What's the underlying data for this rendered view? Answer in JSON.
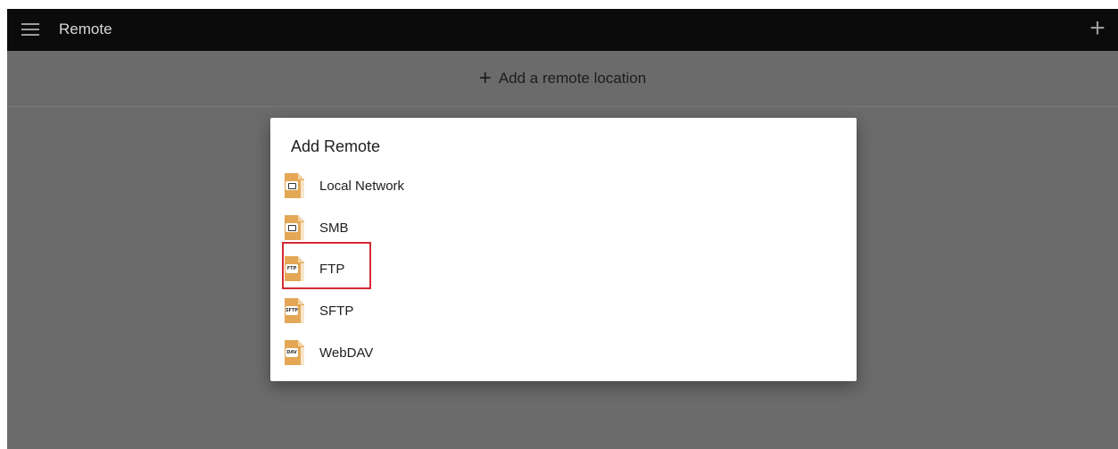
{
  "appbar": {
    "title": "Remote",
    "menu_icon": "hamburger-menu-icon",
    "add_icon": "plus-icon"
  },
  "add_location": {
    "icon": "plus-icon",
    "label": "Add a remote location"
  },
  "dialog": {
    "title": "Add Remote",
    "options": [
      {
        "label": "Local Network",
        "icon": "local-network-icon",
        "badge": ""
      },
      {
        "label": "SMB",
        "icon": "smb-icon",
        "badge": ""
      },
      {
        "label": "FTP",
        "icon": "ftp-icon",
        "badge": "FTP"
      },
      {
        "label": "SFTP",
        "icon": "sftp-icon",
        "badge": "SFTP"
      },
      {
        "label": "WebDAV",
        "icon": "webdav-icon",
        "badge": "DAV"
      }
    ]
  },
  "colors": {
    "appbar": "#0b0b0b",
    "scrim": "#6b6b6b",
    "dialog_bg": "#ffffff",
    "folder_icon": "#e3a756",
    "highlight": "#d42a33"
  }
}
